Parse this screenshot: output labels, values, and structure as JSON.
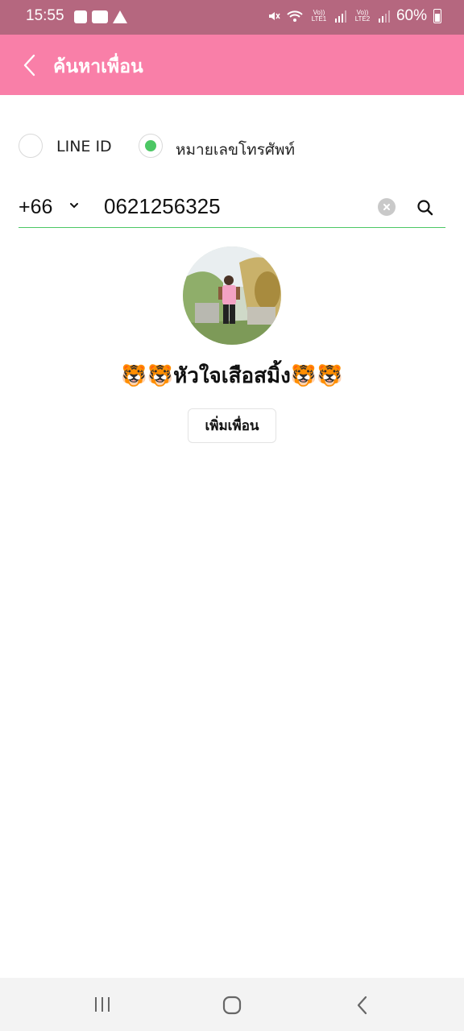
{
  "status_bar": {
    "time": "15:55",
    "lte1": "Vo)) LTE1",
    "lte2": "Vo)) LTE2",
    "battery": "60%"
  },
  "header": {
    "title": "ค้นหาเพื่อน",
    "background": "#f97fa8"
  },
  "search_type": {
    "options": [
      {
        "label": "LINE ID",
        "selected": false
      },
      {
        "label": "หมายเลขโทรศัพท์",
        "selected": true
      }
    ],
    "accent": "#4cc764"
  },
  "phone_search": {
    "country_code": "+66",
    "value": "0621256325"
  },
  "result": {
    "name": "🐯🐯หัวใจเสือสมิ้ง🐯🐯",
    "add_button_label": "เพิ่มเพื่อน"
  },
  "icons": {
    "back": "chevron-left-icon",
    "dropdown": "chevron-down-icon",
    "clear": "clear-circle-icon",
    "search": "search-icon",
    "nav_recent": "recent-apps-icon",
    "nav_home": "home-icon",
    "nav_back": "back-icon"
  }
}
